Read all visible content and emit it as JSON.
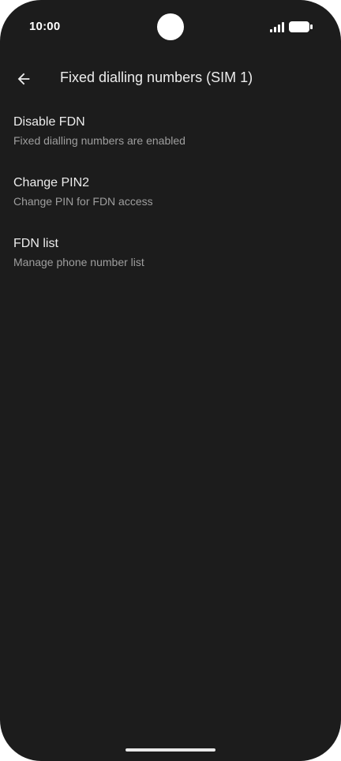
{
  "status_bar": {
    "time": "10:00",
    "icons": [
      "camera-cutout",
      "signal-icon",
      "battery-icon"
    ]
  },
  "app_bar": {
    "back_icon": "arrow-back-icon",
    "title": "Fixed dialling numbers (SIM 1)"
  },
  "items": [
    {
      "title": "Disable FDN",
      "subtitle": "Fixed dialling numbers are enabled"
    },
    {
      "title": "Change PIN2",
      "subtitle": "Change PIN for FDN access"
    },
    {
      "title": "FDN list",
      "subtitle": "Manage phone number list"
    }
  ],
  "colors": {
    "background": "#1c1c1c",
    "text_primary": "#ececec",
    "text_secondary": "#9e9e9e"
  }
}
